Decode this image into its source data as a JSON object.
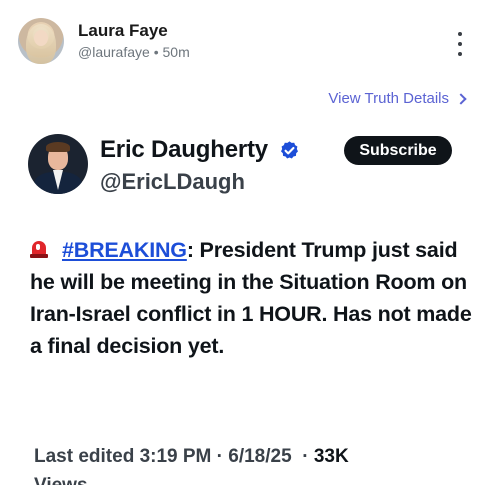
{
  "post": {
    "author_name": "Laura Faye",
    "author_handle": "@laurafaye",
    "separator": "•",
    "time_ago": "50m",
    "view_details_label": "View Truth Details"
  },
  "embedded": {
    "name": "Eric Daugherty",
    "handle": "@EricLDaugh",
    "subscribe_label": "Subscribe",
    "hashtag": "#BREAKING",
    "text": ": President Trump just said he will be meeting in the Situation Room on Iran-Israel conflict in 1 HOUR. Has not made a final decision yet.",
    "edited_label": "Last edited 3:19 PM · 6/18/25",
    "dot": "·",
    "views": "33K",
    "views_cut": "Views"
  },
  "colors": {
    "link": "#5b63d3",
    "hashtag": "#1d4ed8",
    "verified": "#1d4ed8",
    "subscribe_bg": "#0f1419"
  },
  "icons": {
    "more": "more-vertical-icon",
    "chevron": "chevron-right-icon",
    "verified": "verified-badge-icon",
    "siren": "rotating-light-icon"
  }
}
